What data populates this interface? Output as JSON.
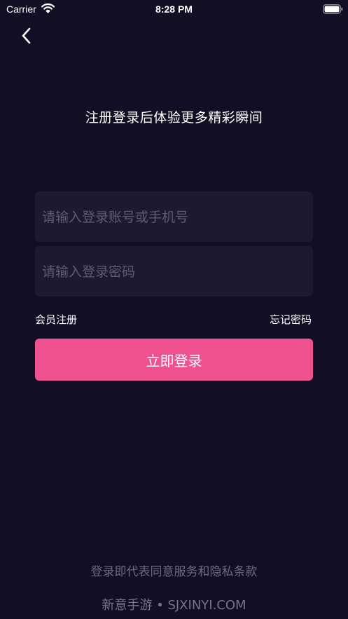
{
  "status_bar": {
    "carrier": "Carrier",
    "time": "8:28 PM",
    "icons": [
      "wifi-icon",
      "battery-icon"
    ]
  },
  "header": {
    "back_icon": "chevron-left-icon",
    "title": "注册登录后体验更多精彩瞬间"
  },
  "form": {
    "account_placeholder": "请输入登录账号或手机号",
    "account_value": "",
    "password_placeholder": "请输入登录密码",
    "password_value": "",
    "register_label": "会员注册",
    "forgot_label": "忘记密码",
    "login_label": "立即登录"
  },
  "footer": {
    "agreement_text": "登录即代表同意服务和隐私条款",
    "watermark": "新意手游 • SJXINYI.COM"
  },
  "colors": {
    "background": "#120f24",
    "input_bg": "#1c1930",
    "accent": "#ef5190",
    "placeholder": "#5f5b72"
  }
}
